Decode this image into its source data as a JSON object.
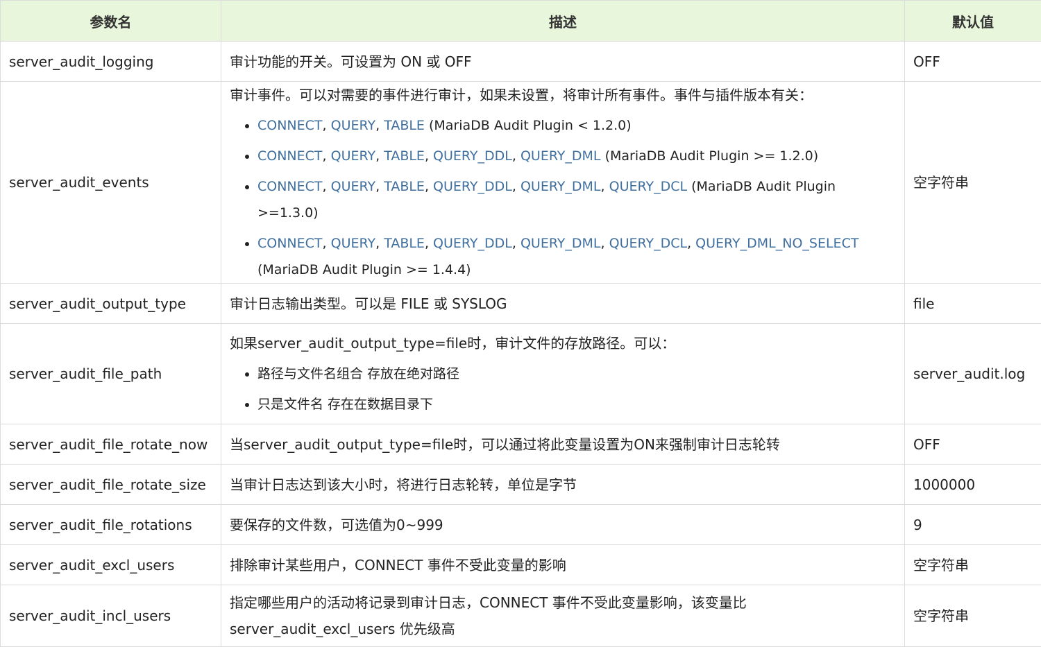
{
  "headers": {
    "name": "参数名",
    "desc": "描述",
    "default": "默认值"
  },
  "rows": [
    {
      "name": "server_audit_logging",
      "desc": "审计功能的开关。可设置为 ON 或 OFF",
      "default": "OFF"
    },
    {
      "name": "server_audit_events",
      "desc": "审计事件。可以对需要的事件进行审计，如果未设置，将审计所有事件。事件与插件版本有关：",
      "default": "空字符串",
      "options": [
        {
          "k1": "CONNECT",
          "k2": "QUERY",
          "k3": "TABLE",
          "tail": " (MariaDB Audit Plugin < 1.2.0)"
        },
        {
          "k1": "CONNECT",
          "k2": "QUERY",
          "k3": "TABLE",
          "k4": "QUERY_DDL",
          "k5": "QUERY_DML",
          "tail": " (MariaDB Audit Plugin >= 1.2.0)"
        },
        {
          "k1": "CONNECT",
          "k2": "QUERY",
          "k3": "TABLE",
          "k4": "QUERY_DDL",
          "k5": "QUERY_DML",
          "k6": "QUERY_DCL",
          "tail": " (MariaDB Audit Plugin >=1.3.0)"
        },
        {
          "k1": "CONNECT",
          "k2": "QUERY",
          "k3": "TABLE",
          "k4": "QUERY_DDL",
          "k5": "QUERY_DML",
          "k6": "QUERY_DCL",
          "k7": "QUERY_DML_NO_SELECT",
          "tail": "(MariaDB Audit Plugin >= 1.4.4)"
        }
      ]
    },
    {
      "name": "server_audit_output_type",
      "desc": "审计日志输出类型。可以是 FILE 或 SYSLOG",
      "default": "file"
    },
    {
      "name": "server_audit_file_path",
      "desc": "如果server_audit_output_type=file时，审计文件的存放路径。可以：",
      "default": "server_audit.log",
      "options": [
        "路径与文件名组合 存放在绝对路径",
        "只是文件名 存在在数据目录下"
      ]
    },
    {
      "name": "server_audit_file_rotate_now",
      "desc": "当server_audit_output_type=file时，可以通过将此变量设置为ON来强制审计日志轮转",
      "default": "OFF"
    },
    {
      "name": "server_audit_file_rotate_size",
      "desc": "当审计日志达到该大小时，将进行日志轮转，单位是字节",
      "default": "1000000"
    },
    {
      "name": "server_audit_file_rotations",
      "desc": "要保存的文件数，可选值为0~999",
      "default": "9"
    },
    {
      "name": "server_audit_excl_users",
      "desc": "排除审计某些用户，CONNECT 事件不受此变量的影响",
      "default": "空字符串"
    },
    {
      "name": "server_audit_incl_users",
      "desc": "指定哪些用户的活动将记录到审计日志，CONNECT 事件不受此变量影响，该变量比 server_audit_excl_users 优先级高",
      "default": "空字符串"
    }
  ],
  "colors": {
    "header_bg": "#e8f6dc",
    "border": "#dcdcdc",
    "keyword": "#3f6f9e",
    "text": "#222222"
  }
}
